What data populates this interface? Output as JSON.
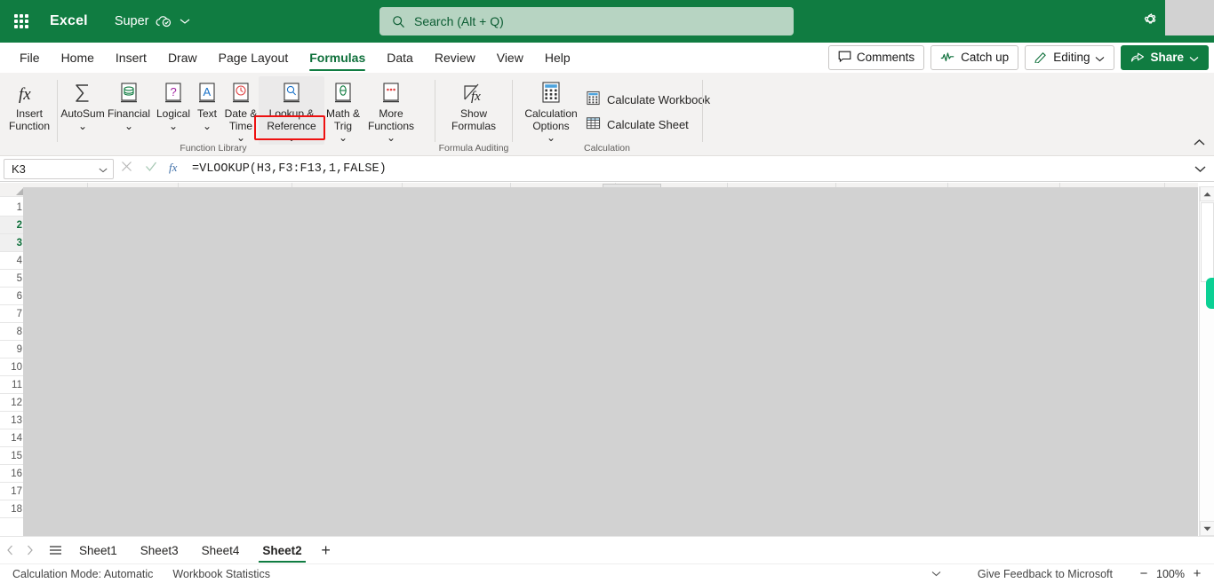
{
  "titlebar": {
    "waffle_label": "App launcher",
    "brand": "Excel",
    "document_name": "Super",
    "search_placeholder": "Search (Alt + Q)"
  },
  "tabs": [
    {
      "label": "File",
      "active": false
    },
    {
      "label": "Home",
      "active": false
    },
    {
      "label": "Insert",
      "active": false
    },
    {
      "label": "Draw",
      "active": false
    },
    {
      "label": "Page Layout",
      "active": false
    },
    {
      "label": "Formulas",
      "active": true
    },
    {
      "label": "Data",
      "active": false
    },
    {
      "label": "Review",
      "active": false
    },
    {
      "label": "View",
      "active": false
    },
    {
      "label": "Help",
      "active": false
    }
  ],
  "tab_actions": {
    "comments": "Comments",
    "catch_up": "Catch up",
    "editing": "Editing",
    "share": "Share"
  },
  "ribbon": {
    "groups": {
      "function_library": "Function Library",
      "formula_auditing": "Formula Auditing",
      "calculation": "Calculation"
    },
    "insert_function": "Insert\nFunction",
    "buttons": [
      {
        "label": "AutoSum",
        "icon": "sigma-icon"
      },
      {
        "label": "Financial",
        "icon": "financial-book-icon"
      },
      {
        "label": "Logical",
        "icon": "logical-book-icon"
      },
      {
        "label": "Text",
        "icon": "text-book-icon"
      },
      {
        "label": "Date &\nTime",
        "icon": "date-time-book-icon"
      },
      {
        "label": "Lookup &\nReference",
        "icon": "lookup-reference-book-icon"
      },
      {
        "label": "Math &\nTrig",
        "icon": "math-trig-book-icon"
      },
      {
        "label": "More\nFunctions",
        "icon": "more-functions-book-icon"
      }
    ],
    "show_formulas": "Show\nFormulas",
    "calculation_options": "Calculation\nOptions",
    "calculate_workbook": "Calculate Workbook",
    "calculate_sheet": "Calculate Sheet"
  },
  "formula_bar": {
    "name_box": "K3",
    "formula": "=VLOOKUP(H3,F3:F13,1,FALSE)",
    "cancel_icon": "close-icon",
    "enter_icon": "check-icon",
    "insert_function_icon": "fx-icon"
  },
  "grid": {
    "rows": [
      "1",
      "2",
      "3",
      "4",
      "5",
      "6",
      "7",
      "8",
      "9",
      "10",
      "11",
      "12",
      "13",
      "14",
      "15",
      "16",
      "17",
      "18"
    ],
    "selected_rows": [
      "2",
      "3"
    ]
  },
  "sheet_tabs": {
    "items": [
      {
        "label": "Sheet1",
        "active": false
      },
      {
        "label": "Sheet3",
        "active": false
      },
      {
        "label": "Sheet4",
        "active": false
      },
      {
        "label": "Sheet2",
        "active": true
      }
    ],
    "add_label": "+"
  },
  "status_bar": {
    "calculation_mode": "Calculation Mode: Automatic",
    "workbook_statistics": "Workbook Statistics",
    "feedback": "Give Feedback to Microsoft",
    "zoom": "100%",
    "zoom_out": "−",
    "zoom_in": "+"
  },
  "colors": {
    "brand_green": "#107c41",
    "highlight_red": "#ee1111",
    "accent_teal": "#0bd094",
    "search_bg": "#b7d4c2"
  }
}
